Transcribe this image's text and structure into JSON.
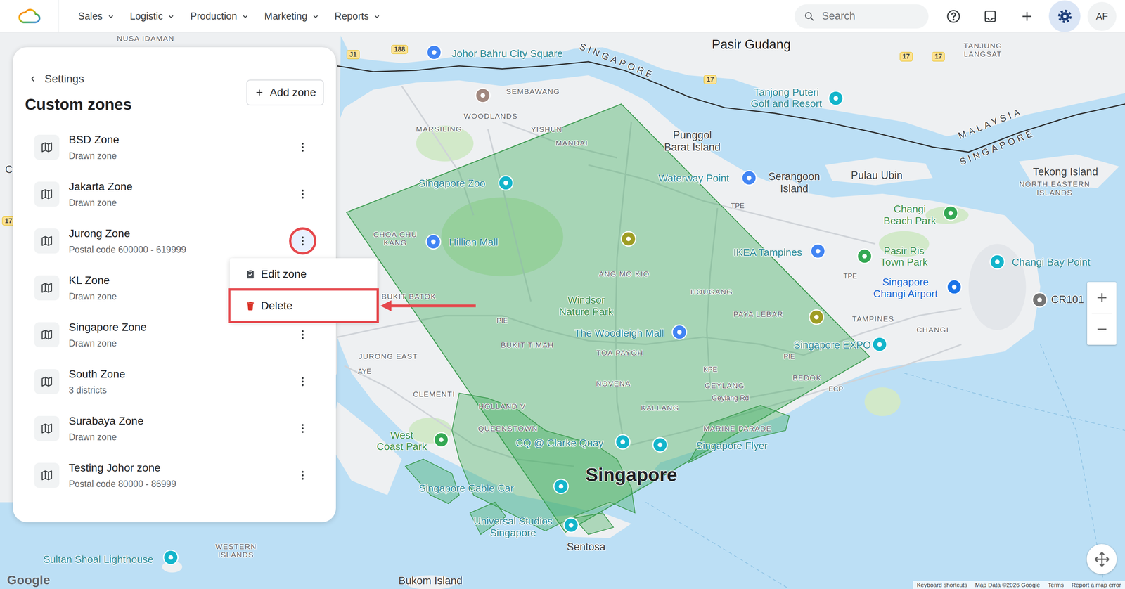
{
  "nav": {
    "menus": [
      {
        "label": "Sales"
      },
      {
        "label": "Logistic"
      },
      {
        "label": "Production"
      },
      {
        "label": "Marketing"
      },
      {
        "label": "Reports"
      }
    ],
    "search": {
      "placeholder": "Search"
    },
    "settings_selected": true,
    "avatar": "AF"
  },
  "panel": {
    "back": "Settings",
    "title": "Custom zones",
    "add_button": "Add zone",
    "zones": [
      {
        "name": "BSD Zone",
        "subtitle": "Drawn zone",
        "menu_open": false
      },
      {
        "name": "Jakarta Zone",
        "subtitle": "Drawn zone",
        "menu_open": false
      },
      {
        "name": "Jurong Zone",
        "subtitle": "Postal code 600000 - 619999",
        "menu_open": true
      },
      {
        "name": "KL Zone",
        "subtitle": "Drawn zone",
        "menu_open": false
      },
      {
        "name": "Singapore Zone",
        "subtitle": "Drawn zone",
        "menu_open": false
      },
      {
        "name": "South Zone",
        "subtitle": "3 districts",
        "menu_open": false
      },
      {
        "name": "Surabaya Zone",
        "subtitle": "Drawn zone",
        "menu_open": false
      },
      {
        "name": "Testing Johor zone",
        "subtitle": "Postal code 80000 - 86999",
        "menu_open": false
      }
    ]
  },
  "zone_menu": {
    "items": [
      {
        "label": "Edit zone",
        "kind": "edit",
        "highlighted": false
      },
      {
        "label": "Delete",
        "kind": "delete",
        "highlighted": true
      }
    ]
  },
  "map": {
    "labels": [
      {
        "text": "NUSA IDAMAN",
        "kind": "district"
      },
      {
        "text": "Johor Bahru City Square",
        "kind": "poi"
      },
      {
        "text": "Pasir Gudang",
        "kind": "town"
      },
      {
        "text": "TANJUNG\nLANGSAT",
        "kind": "district"
      },
      {
        "text": "SEMBAWANG",
        "kind": "district"
      },
      {
        "text": "WOODLANDS",
        "kind": "district"
      },
      {
        "text": "MARSILING",
        "kind": "district"
      },
      {
        "text": "YISHUN",
        "kind": "district"
      },
      {
        "text": "MANDAI",
        "kind": "district"
      },
      {
        "text": "Punggol\nBarat Island",
        "kind": "area"
      },
      {
        "text": "Tanjong Puteri\nGolf and Resort",
        "kind": "poi"
      },
      {
        "text": "SINGAPORE",
        "kind": "border"
      },
      {
        "text": "MALAYSIA",
        "kind": "border"
      },
      {
        "text": "SINGAPORE",
        "kind": "border"
      },
      {
        "text": "Tekong Island",
        "kind": "area"
      },
      {
        "text": "NORTH EASTERN\nISLANDS",
        "kind": "district"
      },
      {
        "text": "Pulau Ubin",
        "kind": "area"
      },
      {
        "text": "Serangoon\nIsland",
        "kind": "area"
      },
      {
        "text": "Waterway Point",
        "kind": "poi"
      },
      {
        "text": "Singapore Zoo",
        "kind": "poi"
      },
      {
        "text": "CHOA CHU\nKANG",
        "kind": "district"
      },
      {
        "text": "Hillion Mall",
        "kind": "poi"
      },
      {
        "text": "ANG MO KIO",
        "kind": "district"
      },
      {
        "text": "IKEA Tampines",
        "kind": "poi"
      },
      {
        "text": "Pasir Ris\nTown Park",
        "kind": "park"
      },
      {
        "text": "Changi\nBeach Park",
        "kind": "park"
      },
      {
        "text": "Changi Bay Point",
        "kind": "poi"
      },
      {
        "text": "Singapore\nChangi Airport",
        "kind": "airport"
      },
      {
        "text": "BUKIT BATOK",
        "kind": "district"
      },
      {
        "text": "Windsor\nNature Park",
        "kind": "park"
      },
      {
        "text": "HOUGANG",
        "kind": "district"
      },
      {
        "text": "PAYA LEBAR",
        "kind": "district"
      },
      {
        "text": "TAMPINES",
        "kind": "district"
      },
      {
        "text": "CHANGI",
        "kind": "district"
      },
      {
        "text": "The Woodleigh Mall",
        "kind": "poi"
      },
      {
        "text": "Singapore EXPO",
        "kind": "poi"
      },
      {
        "text": "BUKIT TIMAH",
        "kind": "district"
      },
      {
        "text": "TOA PAYOH",
        "kind": "district"
      },
      {
        "text": "JURONG EAST",
        "kind": "district"
      },
      {
        "text": "NOVENA",
        "kind": "district"
      },
      {
        "text": "BEDOK",
        "kind": "district"
      },
      {
        "text": "CLEMENTI",
        "kind": "district"
      },
      {
        "text": "GEYLANG",
        "kind": "district"
      },
      {
        "text": "KALLANG",
        "kind": "district"
      },
      {
        "text": "HOLLAND V",
        "kind": "district"
      },
      {
        "text": "QUEENSTOWN",
        "kind": "district"
      },
      {
        "text": "CQ @ Clarke Quay",
        "kind": "poi"
      },
      {
        "text": "Singapore Flyer",
        "kind": "poi"
      },
      {
        "text": "MARINE PARADE",
        "kind": "district"
      },
      {
        "text": "West\nCoast Park",
        "kind": "park"
      },
      {
        "text": "Singapore",
        "kind": "big"
      },
      {
        "text": "Singapore Cable Car",
        "kind": "poi"
      },
      {
        "text": "Universal Studios\nSingapore",
        "kind": "poi"
      },
      {
        "text": "Sentosa",
        "kind": "area"
      },
      {
        "text": "Sultan Shoal Lighthouse",
        "kind": "poi"
      },
      {
        "text": "WESTERN\nISLANDS",
        "kind": "district"
      },
      {
        "text": "Bukom Island",
        "kind": "area"
      },
      {
        "text": "CR101",
        "kind": "area"
      },
      {
        "text": "PIE",
        "kind": "road"
      },
      {
        "text": "AYE",
        "kind": "road"
      },
      {
        "text": "ECP",
        "kind": "road"
      },
      {
        "text": "TPE",
        "kind": "road"
      },
      {
        "text": "TPE",
        "kind": "road"
      },
      {
        "text": "PIE",
        "kind": "road"
      },
      {
        "text": "KPE",
        "kind": "road"
      },
      {
        "text": "Geylang Rd",
        "kind": "road"
      },
      {
        "text": "J1",
        "kind": "shield"
      },
      {
        "text": "188",
        "kind": "shield"
      },
      {
        "text": "17",
        "kind": "shield"
      },
      {
        "text": "17",
        "kind": "shield"
      },
      {
        "text": "17",
        "kind": "shield"
      },
      {
        "text": "Ci",
        "kind": "area"
      },
      {
        "text": "17",
        "kind": "shield"
      }
    ],
    "logo": "Google",
    "attribution": [
      "Keyboard shortcuts",
      "Map Data ©2026 Google",
      "Terms",
      "Report a map error"
    ]
  }
}
